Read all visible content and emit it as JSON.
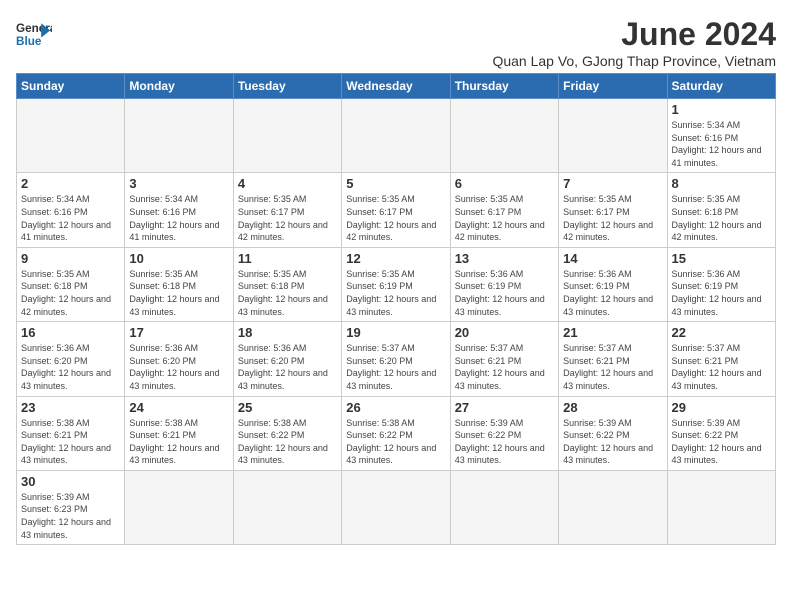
{
  "logo": {
    "line1": "General",
    "line2": "Blue"
  },
  "title": "June 2024",
  "subtitle": "Quan Lap Vo, GJong Thap Province, Vietnam",
  "days_of_week": [
    "Sunday",
    "Monday",
    "Tuesday",
    "Wednesday",
    "Thursday",
    "Friday",
    "Saturday"
  ],
  "weeks": [
    [
      {
        "day": "",
        "info": ""
      },
      {
        "day": "",
        "info": ""
      },
      {
        "day": "",
        "info": ""
      },
      {
        "day": "",
        "info": ""
      },
      {
        "day": "",
        "info": ""
      },
      {
        "day": "",
        "info": ""
      },
      {
        "day": "1",
        "info": "Sunrise: 5:34 AM\nSunset: 6:16 PM\nDaylight: 12 hours and 41 minutes."
      }
    ],
    [
      {
        "day": "2",
        "info": "Sunrise: 5:34 AM\nSunset: 6:16 PM\nDaylight: 12 hours and 41 minutes."
      },
      {
        "day": "3",
        "info": "Sunrise: 5:34 AM\nSunset: 6:16 PM\nDaylight: 12 hours and 41 minutes."
      },
      {
        "day": "4",
        "info": "Sunrise: 5:35 AM\nSunset: 6:17 PM\nDaylight: 12 hours and 42 minutes."
      },
      {
        "day": "5",
        "info": "Sunrise: 5:35 AM\nSunset: 6:17 PM\nDaylight: 12 hours and 42 minutes."
      },
      {
        "day": "6",
        "info": "Sunrise: 5:35 AM\nSunset: 6:17 PM\nDaylight: 12 hours and 42 minutes."
      },
      {
        "day": "7",
        "info": "Sunrise: 5:35 AM\nSunset: 6:17 PM\nDaylight: 12 hours and 42 minutes."
      },
      {
        "day": "8",
        "info": "Sunrise: 5:35 AM\nSunset: 6:18 PM\nDaylight: 12 hours and 42 minutes."
      }
    ],
    [
      {
        "day": "9",
        "info": "Sunrise: 5:35 AM\nSunset: 6:18 PM\nDaylight: 12 hours and 42 minutes."
      },
      {
        "day": "10",
        "info": "Sunrise: 5:35 AM\nSunset: 6:18 PM\nDaylight: 12 hours and 43 minutes."
      },
      {
        "day": "11",
        "info": "Sunrise: 5:35 AM\nSunset: 6:18 PM\nDaylight: 12 hours and 43 minutes."
      },
      {
        "day": "12",
        "info": "Sunrise: 5:35 AM\nSunset: 6:19 PM\nDaylight: 12 hours and 43 minutes."
      },
      {
        "day": "13",
        "info": "Sunrise: 5:36 AM\nSunset: 6:19 PM\nDaylight: 12 hours and 43 minutes."
      },
      {
        "day": "14",
        "info": "Sunrise: 5:36 AM\nSunset: 6:19 PM\nDaylight: 12 hours and 43 minutes."
      },
      {
        "day": "15",
        "info": "Sunrise: 5:36 AM\nSunset: 6:19 PM\nDaylight: 12 hours and 43 minutes."
      }
    ],
    [
      {
        "day": "16",
        "info": "Sunrise: 5:36 AM\nSunset: 6:20 PM\nDaylight: 12 hours and 43 minutes."
      },
      {
        "day": "17",
        "info": "Sunrise: 5:36 AM\nSunset: 6:20 PM\nDaylight: 12 hours and 43 minutes."
      },
      {
        "day": "18",
        "info": "Sunrise: 5:36 AM\nSunset: 6:20 PM\nDaylight: 12 hours and 43 minutes."
      },
      {
        "day": "19",
        "info": "Sunrise: 5:37 AM\nSunset: 6:20 PM\nDaylight: 12 hours and 43 minutes."
      },
      {
        "day": "20",
        "info": "Sunrise: 5:37 AM\nSunset: 6:21 PM\nDaylight: 12 hours and 43 minutes."
      },
      {
        "day": "21",
        "info": "Sunrise: 5:37 AM\nSunset: 6:21 PM\nDaylight: 12 hours and 43 minutes."
      },
      {
        "day": "22",
        "info": "Sunrise: 5:37 AM\nSunset: 6:21 PM\nDaylight: 12 hours and 43 minutes."
      }
    ],
    [
      {
        "day": "23",
        "info": "Sunrise: 5:38 AM\nSunset: 6:21 PM\nDaylight: 12 hours and 43 minutes."
      },
      {
        "day": "24",
        "info": "Sunrise: 5:38 AM\nSunset: 6:21 PM\nDaylight: 12 hours and 43 minutes."
      },
      {
        "day": "25",
        "info": "Sunrise: 5:38 AM\nSunset: 6:22 PM\nDaylight: 12 hours and 43 minutes."
      },
      {
        "day": "26",
        "info": "Sunrise: 5:38 AM\nSunset: 6:22 PM\nDaylight: 12 hours and 43 minutes."
      },
      {
        "day": "27",
        "info": "Sunrise: 5:39 AM\nSunset: 6:22 PM\nDaylight: 12 hours and 43 minutes."
      },
      {
        "day": "28",
        "info": "Sunrise: 5:39 AM\nSunset: 6:22 PM\nDaylight: 12 hours and 43 minutes."
      },
      {
        "day": "29",
        "info": "Sunrise: 5:39 AM\nSunset: 6:22 PM\nDaylight: 12 hours and 43 minutes."
      }
    ],
    [
      {
        "day": "30",
        "info": "Sunrise: 5:39 AM\nSunset: 6:23 PM\nDaylight: 12 hours and 43 minutes."
      },
      {
        "day": "",
        "info": ""
      },
      {
        "day": "",
        "info": ""
      },
      {
        "day": "",
        "info": ""
      },
      {
        "day": "",
        "info": ""
      },
      {
        "day": "",
        "info": ""
      },
      {
        "day": "",
        "info": ""
      }
    ]
  ]
}
